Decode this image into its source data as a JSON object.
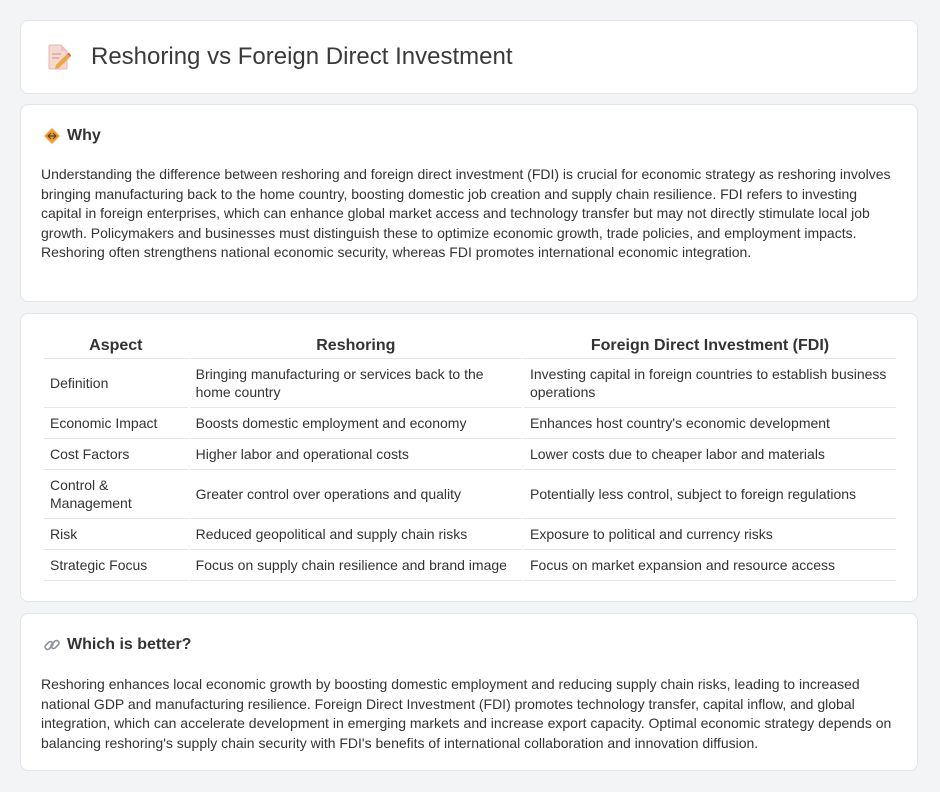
{
  "header": {
    "title": "Reshoring vs Foreign Direct Investment",
    "icon": "document-pencil-icon"
  },
  "why": {
    "title": "Why",
    "icon": "diamond-arrows-icon",
    "body": "Understanding the difference between reshoring and foreign direct investment (FDI) is crucial for economic strategy as reshoring involves bringing manufacturing back to the home country, boosting domestic job creation and supply chain resilience. FDI refers to investing capital in foreign enterprises, which can enhance global market access and technology transfer but may not directly stimulate local job growth. Policymakers and businesses must distinguish these to optimize economic growth, trade policies, and employment impacts. Reshoring often strengthens national economic security, whereas FDI promotes international economic integration."
  },
  "table": {
    "headers": [
      "Aspect",
      "Reshoring",
      "Foreign Direct Investment (FDI)"
    ],
    "rows": [
      [
        "Definition",
        "Bringing manufacturing or services back to the home country",
        "Investing capital in foreign countries to establish business operations"
      ],
      [
        "Economic Impact",
        "Boosts domestic employment and economy",
        "Enhances host country's economic development"
      ],
      [
        "Cost Factors",
        "Higher labor and operational costs",
        "Lower costs due to cheaper labor and materials"
      ],
      [
        "Control & Management",
        "Greater control over operations and quality",
        "Potentially less control, subject to foreign regulations"
      ],
      [
        "Risk",
        "Reduced geopolitical and supply chain risks",
        "Exposure to political and currency risks"
      ],
      [
        "Strategic Focus",
        "Focus on supply chain resilience and brand image",
        "Focus on market expansion and resource access"
      ]
    ]
  },
  "better": {
    "title": "Which is better?",
    "icon": "link-icon",
    "body": "Reshoring enhances local economic growth by boosting domestic employment and reducing supply chain risks, leading to increased national GDP and manufacturing resilience. Foreign Direct Investment (FDI) promotes technology transfer, capital inflow, and global integration, which can accelerate development in emerging markets and increase export capacity. Optimal economic strategy depends on balancing reshoring's supply chain security with FDI's benefits of international collaboration and innovation diffusion."
  },
  "colors": {
    "background": "#f3f4f6",
    "card": "#ffffff",
    "accent": "#f0a030"
  }
}
